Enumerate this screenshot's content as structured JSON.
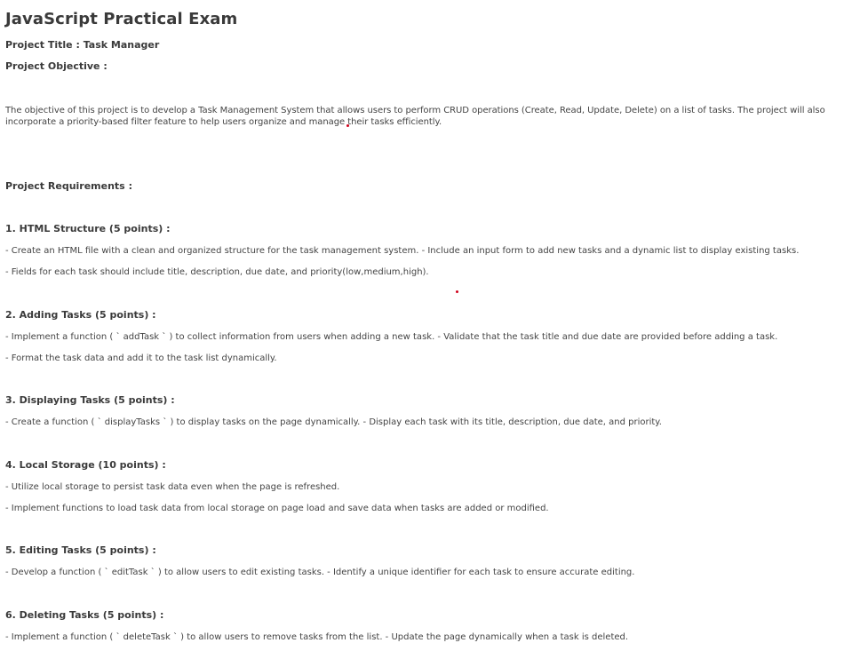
{
  "title": "JavaScript Practical Exam",
  "project_title": "Project Title : Task Manager",
  "project_objective_heading": "Project Objective :",
  "objective_text": "The objective of this project is to develop a Task Management System that allows users to perform CRUD operations (Create, Read, Update, Delete) on a list of tasks. The project will also incorporate a priority-based filter feature to help users organize and manage their tasks efficiently.",
  "requirements_heading": "Project Requirements :",
  "sections": [
    {
      "heading": "1. HTML Structure (5 points) :",
      "lines": [
        "- Create an HTML file with a clean and organized structure for the task management system. - Include an input form to add new tasks and a dynamic list to display existing tasks.",
        "- Fields for each task should include title, description, due date, and priority(low,medium,high)."
      ]
    },
    {
      "heading": "2. Adding Tasks (5 points) :",
      "lines": [
        "- Implement a function ( ` addTask ` ) to collect information from users when adding a new task. - Validate that the task title and due date are provided before adding a task.",
        "- Format the task data and add it to the task list dynamically."
      ]
    },
    {
      "heading": "3. Displaying Tasks (5 points) :",
      "lines": [
        "- Create a function ( ` displayTasks ` ) to display tasks on the page dynamically. - Display each task with its title, description, due date, and priority."
      ]
    },
    {
      "heading": "4. Local Storage (10 points) :",
      "lines": [
        "- Utilize local storage to persist task data even when the page is refreshed.",
        "- Implement functions to load task data from local storage on page load and save data when tasks are added or modified."
      ]
    },
    {
      "heading": "5. Editing Tasks (5 points) :",
      "lines": [
        "- Develop a function ( ` editTask ` ) to allow users to edit existing tasks. - Identify a unique identifier for each task to ensure accurate editing."
      ]
    },
    {
      "heading": "6. Deleting Tasks (5 points) :",
      "lines": [
        "- Implement a function ( ` deleteTask ` ) to allow users to remove tasks from the list. - Update the page dynamically when a task is deleted."
      ]
    }
  ],
  "colors": {
    "text": "#3a3a3a",
    "marker_dot": "#d0021b"
  }
}
